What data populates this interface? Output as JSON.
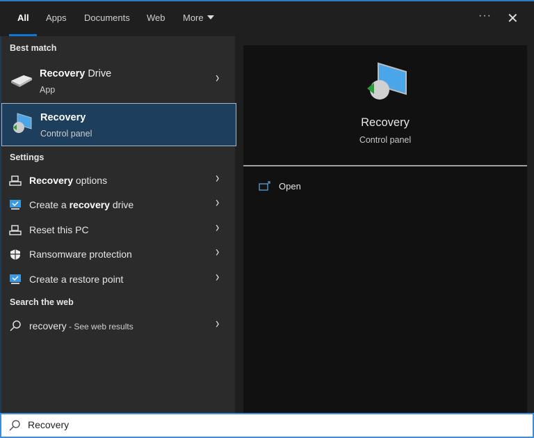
{
  "tabs": [
    {
      "label": "All"
    },
    {
      "label": "Apps"
    },
    {
      "label": "Documents"
    },
    {
      "label": "Web"
    },
    {
      "label": "More"
    }
  ],
  "best_match": {
    "heading": "Best match",
    "items": [
      {
        "bold": "Recovery",
        "rest": " Drive",
        "subtitle": "App"
      },
      {
        "bold": "Recovery",
        "rest": "",
        "subtitle": "Control panel"
      }
    ]
  },
  "settings": {
    "heading": "Settings",
    "items": [
      {
        "pre": "",
        "bold": "Recovery",
        "post": " options",
        "icon": "reset-icon"
      },
      {
        "pre": "Create a ",
        "bold": "recovery",
        "post": " drive",
        "icon": "monitor-icon"
      },
      {
        "pre": "Reset this PC",
        "bold": "",
        "post": "",
        "icon": "reset-icon"
      },
      {
        "pre": "Ransomware protection",
        "bold": "",
        "post": "",
        "icon": "shield-icon"
      },
      {
        "pre": "Create a restore point",
        "bold": "",
        "post": "",
        "icon": "monitor-icon"
      }
    ]
  },
  "web": {
    "heading": "Search the web",
    "query": "recovery",
    "suffix": " - See web results"
  },
  "preview": {
    "title": "Recovery",
    "subtitle": "Control panel",
    "open_label": "Open"
  },
  "search": {
    "value": "Recovery"
  },
  "colors": {
    "accent": "#0a78d4",
    "selected": "#1d3e5c"
  }
}
